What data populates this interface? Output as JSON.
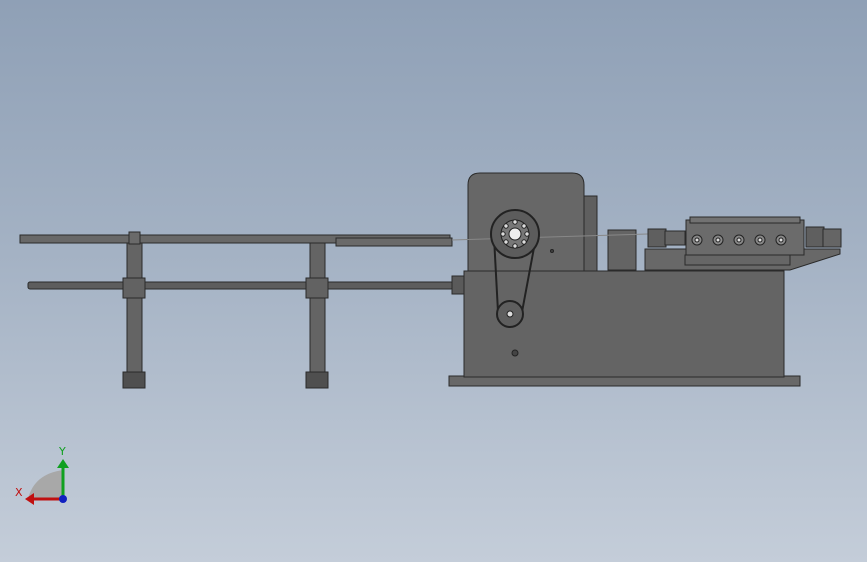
{
  "viewport": {
    "background_top": "#8fa0b6",
    "background_bottom": "#c4cdd9",
    "model": {
      "body_color": "#666666",
      "edge_color": "#2a2a2a",
      "rod_color": "#5d5d5d"
    }
  },
  "triad": {
    "x_label": "X",
    "y_label": "Y",
    "x_color": "#c01010",
    "y_color": "#10a020",
    "z_color": "#1020c0"
  }
}
